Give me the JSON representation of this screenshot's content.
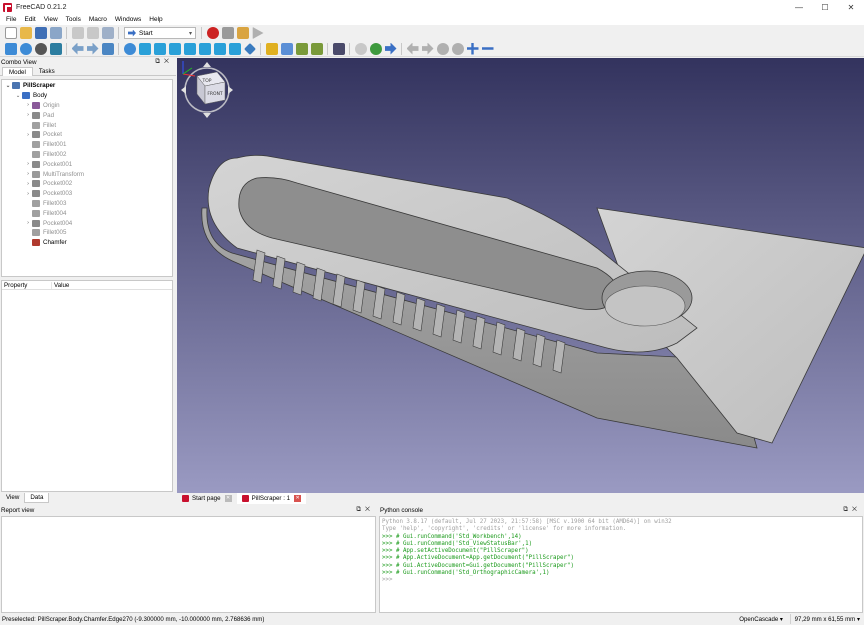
{
  "window": {
    "title": "FreeCAD 0.21.2",
    "controls": [
      "—",
      "☐",
      "✕"
    ]
  },
  "menu": [
    "File",
    "Edit",
    "View",
    "Tools",
    "Macro",
    "Windows",
    "Help"
  ],
  "workbench": {
    "selected": "Start"
  },
  "combo_view": {
    "title": "Combo View",
    "tabs": [
      "Model",
      "Tasks"
    ],
    "tree": [
      {
        "label": "PillScraper",
        "depth": 0,
        "arrow": "⌄",
        "style": "bold"
      },
      {
        "label": "Body",
        "depth": 1,
        "arrow": "⌄",
        "style": "normal"
      },
      {
        "label": "Origin",
        "depth": 2,
        "arrow": "›",
        "style": "grey"
      },
      {
        "label": "Pad",
        "depth": 2,
        "arrow": "›",
        "style": "grey"
      },
      {
        "label": "Fillet",
        "depth": 2,
        "arrow": "",
        "style": "grey"
      },
      {
        "label": "Pocket",
        "depth": 2,
        "arrow": "›",
        "style": "grey"
      },
      {
        "label": "Fillet001",
        "depth": 2,
        "arrow": "",
        "style": "grey"
      },
      {
        "label": "Fillet002",
        "depth": 2,
        "arrow": "",
        "style": "grey"
      },
      {
        "label": "Pocket001",
        "depth": 2,
        "arrow": "›",
        "style": "grey"
      },
      {
        "label": "MultiTransform",
        "depth": 2,
        "arrow": "›",
        "style": "grey"
      },
      {
        "label": "Pocket002",
        "depth": 2,
        "arrow": "›",
        "style": "grey"
      },
      {
        "label": "Pocket003",
        "depth": 2,
        "arrow": "›",
        "style": "grey"
      },
      {
        "label": "Fillet003",
        "depth": 2,
        "arrow": "",
        "style": "grey"
      },
      {
        "label": "Fillet004",
        "depth": 2,
        "arrow": "",
        "style": "grey"
      },
      {
        "label": "Pocket004",
        "depth": 2,
        "arrow": "›",
        "style": "grey"
      },
      {
        "label": "Fillet005",
        "depth": 2,
        "arrow": "",
        "style": "grey"
      },
      {
        "label": "Chamfer",
        "depth": 2,
        "arrow": "",
        "style": "normal"
      }
    ],
    "property_headers": [
      "Property",
      "Value"
    ],
    "bottom_tabs": [
      "View",
      "Data"
    ]
  },
  "navcube": {
    "top": "TOP",
    "front": "FRONT"
  },
  "document_tabs": [
    {
      "label": "Start page",
      "active": false
    },
    {
      "label": "PillScraper : 1",
      "active": true
    }
  ],
  "report_view": {
    "title": "Report view"
  },
  "python_console": {
    "title": "Python console",
    "lines": [
      {
        "text": "Python 3.8.17 (default, Jul 27 2023, 21:57:58) [MSC v.1900 64 bit (AMD64)] on win32",
        "kind": "header"
      },
      {
        "text": "Type 'help', 'copyright', 'credits' or 'license' for more information.",
        "kind": "header"
      },
      {
        "text": ">>> # Gui.runCommand('Std_Workbench',14)",
        "kind": "cmd"
      },
      {
        "text": ">>> # Gui.runCommand('Std_ViewStatusBar',1)",
        "kind": "cmd"
      },
      {
        "text": ">>> # App.setActiveDocument(\"PillScraper\")",
        "kind": "cmd"
      },
      {
        "text": ">>> # App.ActiveDocument=App.getDocument(\"PillScraper\")",
        "kind": "cmd"
      },
      {
        "text": ">>> # Gui.ActiveDocument=Gui.getDocument(\"PillScraper\")",
        "kind": "cmd"
      },
      {
        "text": ">>> # Gui.runCommand('Std_OrthographicCamera',1)",
        "kind": "cmd"
      },
      {
        "text": ">>>",
        "kind": "prompt"
      }
    ]
  },
  "status": {
    "message": "Preselected: PillScraper.Body.Chamfer.Edge270 (-9.300000 mm, -10.000000 mm, 2.768636 mm)",
    "renderer": "OpenCascade ▾",
    "dimensions": "97,29 mm x 61,55 mm ▾"
  },
  "colors": {
    "accent": "#c8102e",
    "viewport_top": "#33335e",
    "viewport_bottom": "#9a9ac2",
    "model_face": "#c9c9c9",
    "console_command": "#1a9a1a"
  }
}
